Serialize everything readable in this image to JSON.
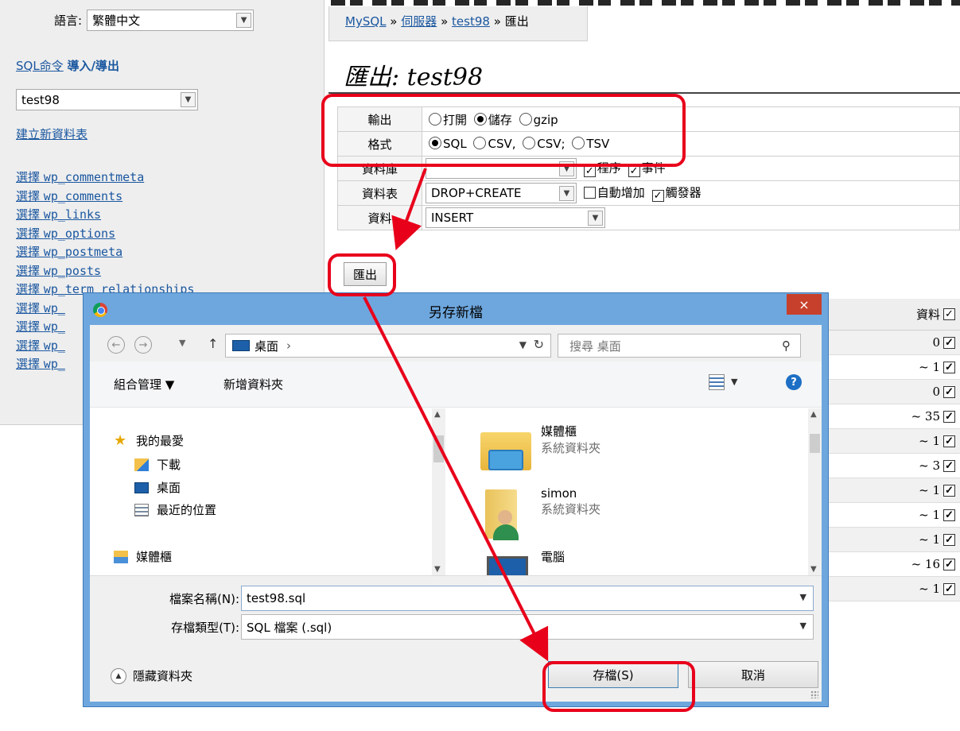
{
  "sidebar": {
    "language_label": "語言:",
    "language_value": "繁體中文",
    "sql_command_link": "SQL命令",
    "import_export_link": "導入/導出",
    "database_value": "test98",
    "create_table_link": "建立新資料表",
    "select_word": "選擇",
    "tables": [
      "wp_commentmeta",
      "wp_comments",
      "wp_links",
      "wp_options",
      "wp_postmeta",
      "wp_posts",
      "wp_term_relationships",
      "wp_",
      "wp_",
      "wp_",
      "wp_"
    ]
  },
  "breadcrumb": {
    "mysql": "MySQL",
    "server": "伺服器",
    "db": "test98",
    "current": "匯出",
    "separator": "»"
  },
  "page": {
    "title_prefix": "匯出",
    "title_db": "test98"
  },
  "form": {
    "output_label": "輸出",
    "output_options": [
      "打開",
      "儲存",
      "gzip"
    ],
    "output_selected": "儲存",
    "format_label": "格式",
    "format_options": [
      "SQL",
      "CSV,",
      "CSV;",
      "TSV"
    ],
    "format_selected": "SQL",
    "database_label": "資料庫",
    "database_value": "",
    "routines_label": "程序",
    "events_label": "事件",
    "tables_label": "資料表",
    "tables_value": "DROP+CREATE",
    "auto_increment_label": "自動增加",
    "triggers_label": "觸發器",
    "data_label": "資料",
    "data_value": "INSERT",
    "export_button": "匯出"
  },
  "right_table": {
    "header": "資料",
    "rows": [
      "0",
      "~ 1",
      "0",
      "~ 35",
      "~ 1",
      "~ 3",
      "~ 1",
      "~ 1",
      "~ 1",
      "~ 16",
      "~ 1"
    ]
  },
  "dialog": {
    "title": "另存新檔",
    "close": "×",
    "address": "桌面",
    "address_sep": "›",
    "search_placeholder": "搜尋 桌面",
    "organize": "組合管理 ▼",
    "new_folder": "新增資料夾",
    "nav_items": [
      "我的最愛",
      "下載",
      "桌面",
      "最近的位置",
      "媒體櫃"
    ],
    "files": [
      {
        "name": "媒體櫃",
        "type": "系統資料夾"
      },
      {
        "name": "simon",
        "type": "系統資料夾"
      },
      {
        "name": "電腦",
        "type": ""
      }
    ],
    "filename_label": "檔案名稱(N):",
    "filename_value": "test98.sql",
    "filetype_label": "存檔類型(T):",
    "filetype_value": "SQL 檔案 (.sql)",
    "hide_folders": "隱藏資料夾",
    "save_button": "存檔(S)",
    "cancel_button": "取消"
  },
  "colors": {
    "link": "#1a57a0",
    "annotation_red": "#e8001b",
    "dialog_frame": "#6ea7de"
  }
}
